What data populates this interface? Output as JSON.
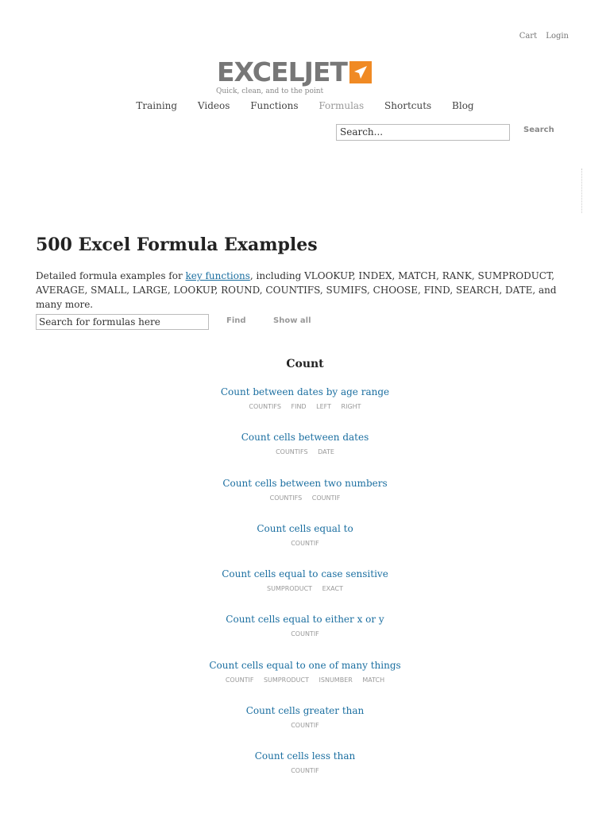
{
  "header": {
    "cart": "Cart",
    "login": "Login",
    "logo_text": "EXCELJET",
    "tagline": "Quick, clean, and to the point",
    "brand_color": "#f08a24"
  },
  "nav": {
    "items": [
      {
        "label": "Training"
      },
      {
        "label": "Videos"
      },
      {
        "label": "Functions"
      },
      {
        "label": "Formulas"
      },
      {
        "label": "Shortcuts"
      },
      {
        "label": "Blog"
      }
    ],
    "active": "Formulas"
  },
  "site_search": {
    "placeholder": "Search...",
    "button": "Search"
  },
  "page": {
    "title": "500 Excel Formula Examples",
    "intro_before": "Detailed formula examples for ",
    "intro_link": "key functions",
    "intro_after": ", including VLOOKUP, INDEX, MATCH, RANK, SUMPRODUCT, AVERAGE, SMALL, LARGE, LOOKUP, ROUND, COUNTIFS, SUMIFS, CHOOSE, FIND, SEARCH, DATE, and many more."
  },
  "formula_search": {
    "placeholder": "Search for formulas here",
    "find": "Find",
    "show_all": "Show all"
  },
  "section": {
    "title": "Count",
    "items": [
      {
        "title": "Count between dates by age range",
        "tags": [
          "COUNTIFS",
          "FIND",
          "LEFT",
          "RIGHT"
        ]
      },
      {
        "title": "Count cells between dates",
        "tags": [
          "COUNTIFS",
          "DATE"
        ]
      },
      {
        "title": "Count cells between two numbers",
        "tags": [
          "COUNTIFS",
          "COUNTIF"
        ]
      },
      {
        "title": "Count cells equal to",
        "tags": [
          "COUNTIF"
        ]
      },
      {
        "title": "Count cells equal to case sensitive",
        "tags": [
          "SUMPRODUCT",
          "EXACT"
        ]
      },
      {
        "title": "Count cells equal to either x or y",
        "tags": [
          "COUNTIF"
        ]
      },
      {
        "title": "Count cells equal to one of many things",
        "tags": [
          "COUNTIF",
          "SUMPRODUCT",
          "ISNUMBER",
          "MATCH"
        ]
      },
      {
        "title": "Count cells greater than",
        "tags": [
          "COUNTIF"
        ]
      },
      {
        "title": "Count cells less than",
        "tags": [
          "COUNTIF"
        ]
      }
    ]
  }
}
